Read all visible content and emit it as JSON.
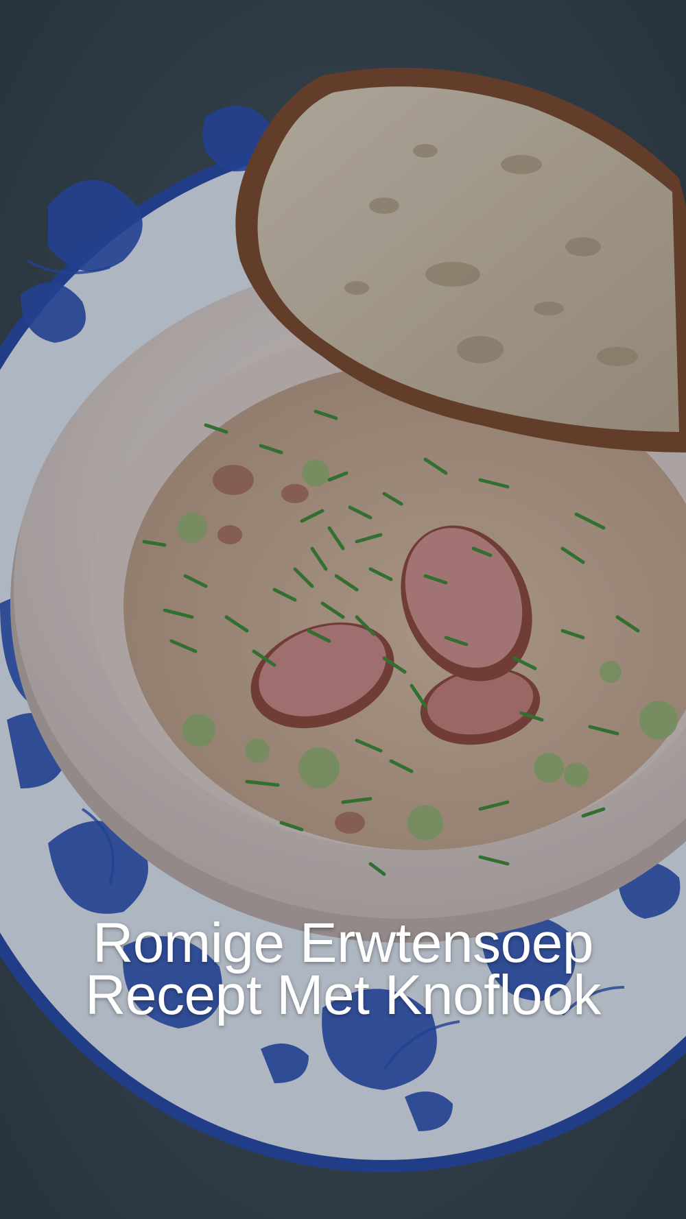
{
  "pin": {
    "title_line_1": "Romige Erwtensoep",
    "title_line_2": "Recept Met Knoflook"
  },
  "photo": {
    "subject": "bowl of creamy pea soup with sausage slices and chives, slice of bread, blue-and-white patterned plate",
    "colors": {
      "table": "#3f4d55",
      "plate": "#dfe6f0",
      "plate_pattern": "#2b4fae",
      "bowl": "#e6dcd6",
      "soup": "#c9ab92",
      "sausage": "#b0665a",
      "chives": "#3f7d33",
      "bread_crust": "#8a5230",
      "bread_crumb": "#cfc2ad"
    }
  }
}
